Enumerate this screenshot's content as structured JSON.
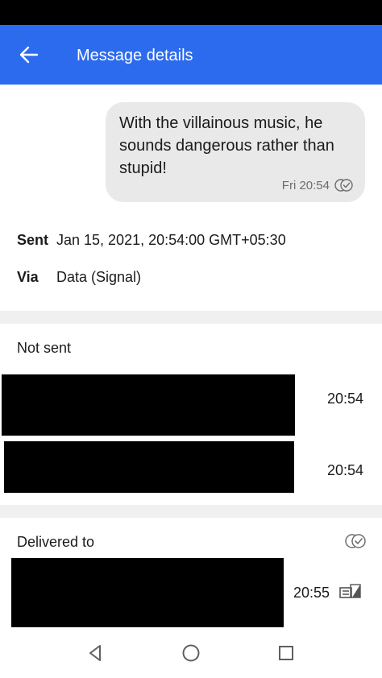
{
  "appbar": {
    "title": "Message details",
    "back_icon": "arrow-left-icon",
    "color": "#2c6bed"
  },
  "message": {
    "text": "With the villainous music, he sounds dangerous rather than stupid!",
    "time": "Fri 20:54",
    "status_icon": "delivered-double-check-icon"
  },
  "details": {
    "sent_label": "Sent",
    "sent_value": "Jan 15, 2021, 20:54:00 GMT+05:30",
    "via_label": "Via",
    "via_value": "Data (Signal)"
  },
  "not_sent": {
    "title": "Not sent",
    "recipients": [
      {
        "time": "20:54"
      },
      {
        "time": "20:54"
      }
    ]
  },
  "delivered": {
    "title": "Delivered to",
    "status_icon": "delivered-double-check-icon",
    "recipients": [
      {
        "time": "20:55",
        "icon": "sealed-sender-icon"
      }
    ]
  },
  "navbar": {
    "back": "nav-back-icon",
    "home": "nav-home-icon",
    "recents": "nav-recents-icon"
  }
}
